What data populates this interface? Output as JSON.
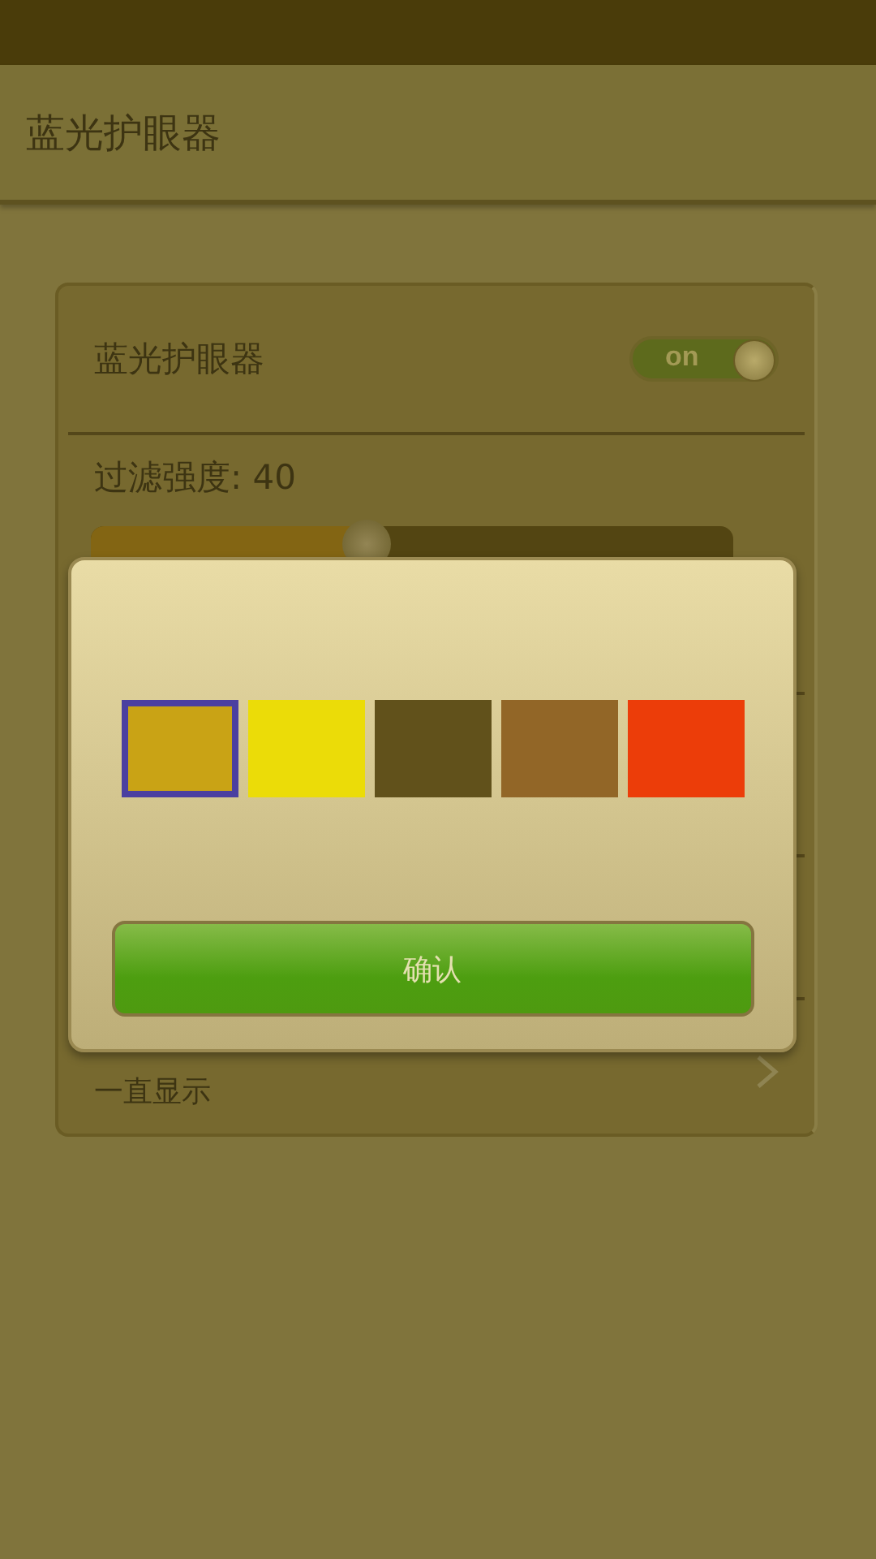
{
  "header": {
    "title": "蓝光护眼器"
  },
  "switch_row": {
    "label": "蓝光护眼器",
    "on": true,
    "switch_text": "on"
  },
  "filter": {
    "label": "过滤强度: 40",
    "level": 0.43
  },
  "notification": {
    "value": "一直显示"
  },
  "dialog": {
    "swatches": [
      {
        "color": "#c9a315",
        "selected": true
      },
      {
        "color": "#ebdc08",
        "selected": false
      },
      {
        "color": "#61511b",
        "selected": false
      },
      {
        "color": "#926627",
        "selected": false
      },
      {
        "color": "#ec3d09",
        "selected": false
      }
    ],
    "confirm": "确认"
  }
}
